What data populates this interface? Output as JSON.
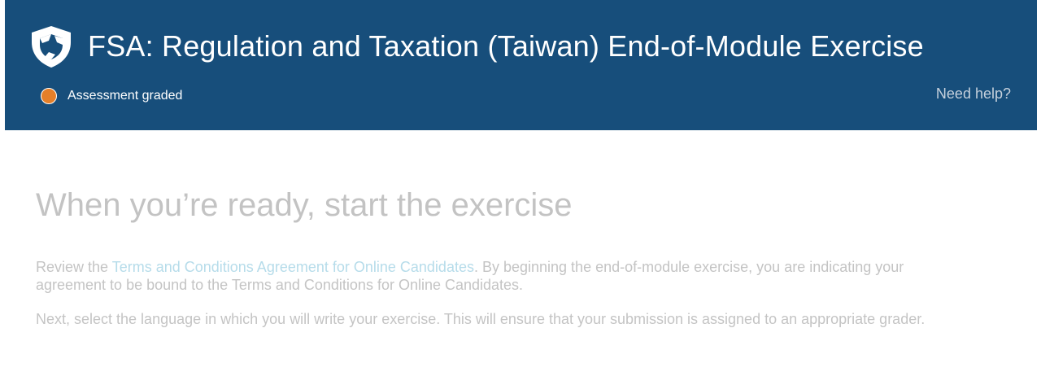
{
  "header": {
    "logo_icon": "shield-logo-icon",
    "title": "FSA: Regulation and Taxation (Taiwan) End-of-Module Exercise",
    "status": {
      "label": "Assessment graded",
      "color": "#e47f29"
    },
    "help_link": "Need help?",
    "background_color": "#174e7b"
  },
  "main": {
    "heading": "When you’re ready, start the exercise",
    "paragraph1": {
      "prefix": "Review the ",
      "link_text": "Terms and Conditions Agreement for Online Candidates",
      "suffix": ". By beginning the end-of-module exercise, you are indicating your agreement to be bound to the Terms and Conditions for Online Candidates."
    },
    "paragraph2": "Next, select the language in which you will write your exercise. This will ensure that your submission is assigned to an appropriate grader."
  }
}
